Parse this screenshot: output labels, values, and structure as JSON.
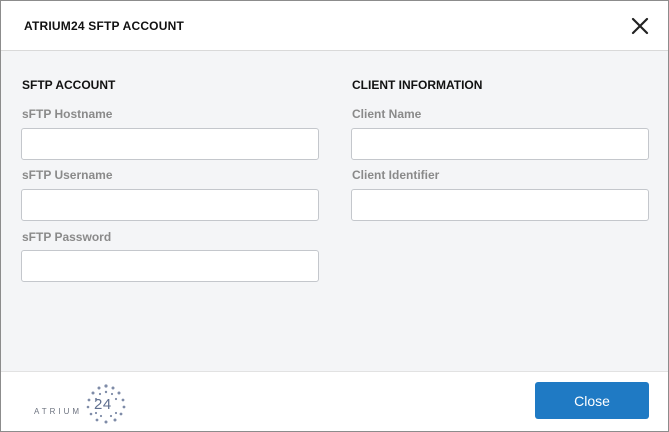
{
  "dialog": {
    "title": "ATRIUM24 SFTP ACCOUNT",
    "close_icon": "close-x-icon"
  },
  "sftp_account": {
    "section_title": "SFTP ACCOUNT",
    "hostname": {
      "label": "sFTP Hostname",
      "value": ""
    },
    "username": {
      "label": "sFTP Username",
      "value": ""
    },
    "password": {
      "label": "sFTP Password",
      "value": ""
    }
  },
  "client_information": {
    "section_title": "CLIENT INFORMATION",
    "client_name": {
      "label": "Client Name",
      "value": ""
    },
    "client_identifier": {
      "label": "Client Identifier",
      "value": ""
    }
  },
  "footer": {
    "logo_text": "ATRIUM",
    "logo_number": "24",
    "close_button": "Close"
  },
  "colors": {
    "primary_button": "#1f7ac4",
    "body_background": "#f4f5f7",
    "label_gray": "#8a8a8a"
  }
}
